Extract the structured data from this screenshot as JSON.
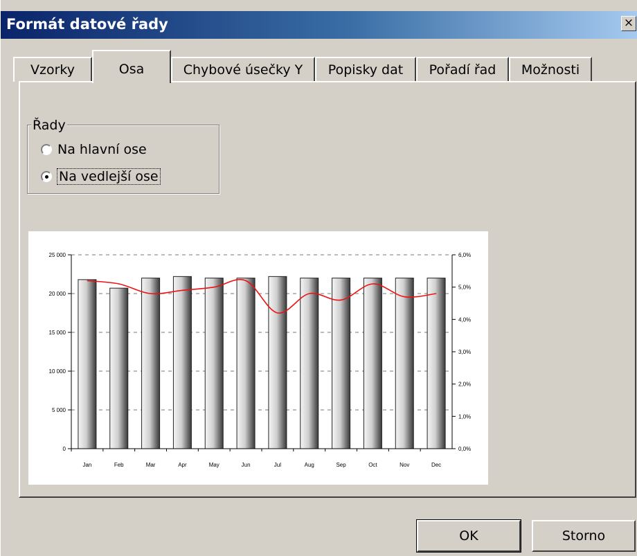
{
  "window": {
    "title": "Formát datové řady",
    "close_label": "×"
  },
  "tabs": [
    {
      "label": "Vzorky",
      "active": false
    },
    {
      "label": "Osa",
      "active": true
    },
    {
      "label": "Chybové úsečky Y",
      "active": false
    },
    {
      "label": "Popisky dat",
      "active": false
    },
    {
      "label": "Pořadí řad",
      "active": false
    },
    {
      "label": "Možnosti",
      "active": false
    }
  ],
  "group": {
    "label": "Řady",
    "options": [
      {
        "label": "Na hlavní ose",
        "checked": false
      },
      {
        "label": "Na vedlejší ose",
        "checked": true
      }
    ]
  },
  "chart_data": {
    "type": "bar",
    "categories": [
      "Jan",
      "Feb",
      "Mar",
      "Apr",
      "May",
      "Jun",
      "Jul",
      "Aug",
      "Sep",
      "Oct",
      "Nov",
      "Dec"
    ],
    "series": [
      {
        "type": "bar",
        "axis": "primary",
        "values": [
          21800,
          20700,
          22000,
          22200,
          22000,
          22000,
          22200,
          22000,
          22000,
          22000,
          22000,
          22000
        ]
      },
      {
        "type": "line",
        "axis": "secondary",
        "color": "#ee1111",
        "values": [
          5.2,
          5.1,
          4.8,
          4.9,
          5.0,
          5.2,
          4.2,
          4.8,
          4.6,
          5.1,
          4.7,
          4.8
        ]
      }
    ],
    "y_primary": {
      "ylim": [
        0,
        25000
      ],
      "ticks": [
        "0",
        "5 000",
        "10 000",
        "15 000",
        "20 000",
        "25 000"
      ]
    },
    "y_secondary": {
      "ylim": [
        0,
        6
      ],
      "ticks": [
        "0,0%",
        "1,0%",
        "2,0%",
        "3,0%",
        "4,0%",
        "5,0%",
        "6,0%"
      ]
    },
    "grid": "dashed-horizontal",
    "legend": "none"
  },
  "buttons": {
    "ok": "OK",
    "cancel": "Storno"
  }
}
